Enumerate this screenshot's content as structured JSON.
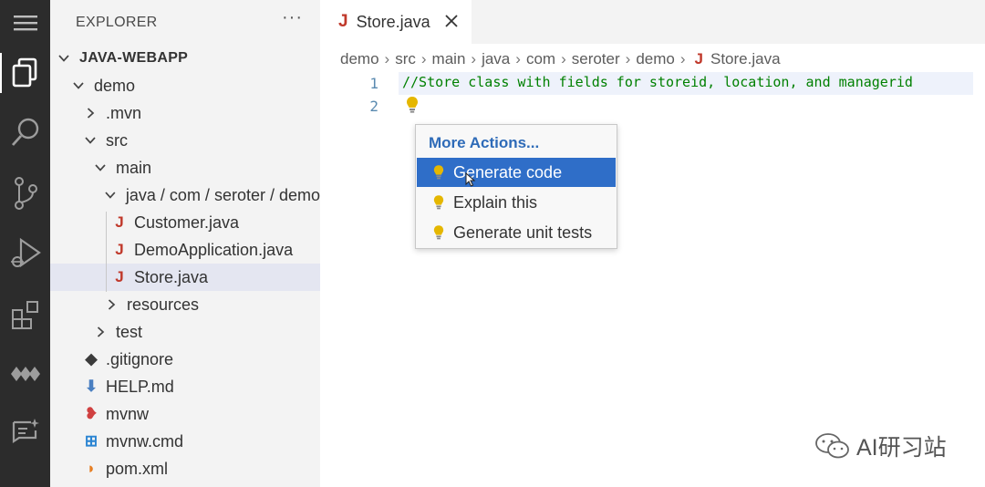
{
  "explorer": {
    "title": "EXPLORER",
    "more": "···",
    "tree": [
      {
        "label": "JAVA-WEBAPP",
        "level": 0,
        "kind": "folder-open",
        "bold": true
      },
      {
        "label": "demo",
        "level": 1,
        "kind": "folder-open"
      },
      {
        "label": ".mvn",
        "level": 2,
        "kind": "folder-closed"
      },
      {
        "label": "src",
        "level": 2,
        "kind": "folder-open"
      },
      {
        "label": "main",
        "level": 3,
        "kind": "folder-open"
      },
      {
        "label": "java / com / seroter / demo",
        "level": 4,
        "kind": "folder-open"
      },
      {
        "label": "Customer.java",
        "level": 5,
        "kind": "java"
      },
      {
        "label": "DemoApplication.java",
        "level": 5,
        "kind": "java"
      },
      {
        "label": "Store.java",
        "level": 5,
        "kind": "java",
        "selected": true
      },
      {
        "label": "resources",
        "level": 4,
        "kind": "folder-closed"
      },
      {
        "label": "test",
        "level": 3,
        "kind": "folder-closed"
      },
      {
        "label": ".gitignore",
        "level": 2,
        "kind": "gitignore"
      },
      {
        "label": "HELP.md",
        "level": 2,
        "kind": "markdown"
      },
      {
        "label": "mvnw",
        "level": 2,
        "kind": "mvnw"
      },
      {
        "label": "mvnw.cmd",
        "level": 2,
        "kind": "windows"
      },
      {
        "label": "pom.xml",
        "level": 2,
        "kind": "rss"
      }
    ]
  },
  "activity_bar": [
    "files-icon",
    "search-icon",
    "source-control-icon",
    "run-debug-icon",
    "extensions-icon",
    "remote-icon",
    "chat-icon"
  ],
  "editor": {
    "tab": {
      "label": "Store.java",
      "icon": "J"
    },
    "breadcrumbs": [
      "demo",
      "src",
      "main",
      "java",
      "com",
      "seroter",
      "demo"
    ],
    "breadcrumb_file": "Store.java",
    "breadcrumb_file_icon": "J",
    "line_numbers": [
      "1",
      "2"
    ],
    "code": "//Store class with fields for storeid, location, and managerid"
  },
  "menu": {
    "header": "More Actions...",
    "items": [
      {
        "label": "Generate code",
        "active": true
      },
      {
        "label": "Explain this"
      },
      {
        "label": "Generate unit tests"
      }
    ]
  },
  "watermark": "AI研习站",
  "colors": {
    "accent": "#2f6ec8",
    "java": "#c0392b",
    "comment": "#008000",
    "bulb": "#e5b700"
  }
}
